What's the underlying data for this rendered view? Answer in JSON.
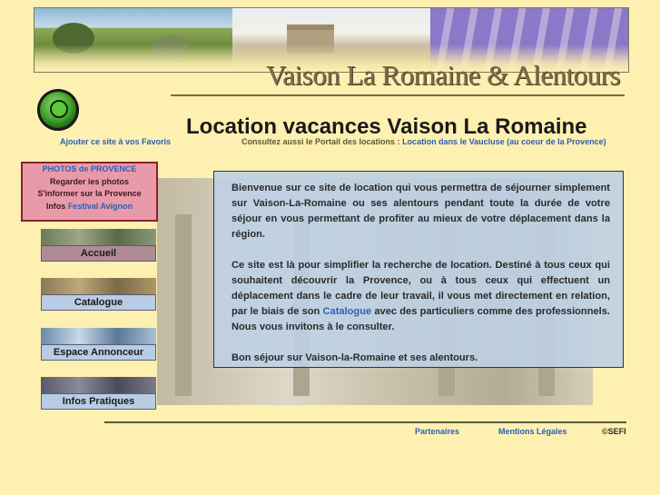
{
  "header": {
    "site_title": "Vaison La Romaine & Alentours"
  },
  "main": {
    "heading": "Location vacances Vaison La Romaine",
    "favorites_link": "Ajouter ce site à vos Favoris",
    "portal_text": "Consultez aussi le Portail des locations :",
    "portal_link": "Location dans le Vaucluse (au coeur de la Provence)"
  },
  "sidebar": {
    "box_items": [
      {
        "prefix": "",
        "label": "PHOTOS de PROVENCE",
        "highlight": true
      },
      {
        "prefix": "",
        "label": "Regarder les photos",
        "highlight": false
      },
      {
        "prefix": "",
        "label": "S'informer sur la Provence",
        "highlight": false
      },
      {
        "prefix": "Infos ",
        "label": "Festival Avignon",
        "highlight": true
      }
    ],
    "nav": [
      {
        "label": "Accueil"
      },
      {
        "label": "Catalogue"
      },
      {
        "label": "Espace Annonceur"
      },
      {
        "label": "Infos Pratiques"
      }
    ]
  },
  "content": {
    "p1": "Bienvenue sur ce site de location qui vous permettra de séjourner simplement sur Vaison-La-Romaine ou ses alentours pendant toute la durée de votre séjour en vous permettant de profiter au mieux de votre déplacement dans la région.",
    "p2_before": "Ce site est là pour simplifier la recherche de location. Destiné à tous ceux qui souhaitent découvrir la Provence, ou à tous ceux qui effectuent un déplacement dans le cadre de leur travail, il vous met directement en relation, par le biais de son ",
    "p2_link": "Catalogue",
    "p2_after": " avec des particuliers comme des professionnels. Nous vous invitons à le consulter.",
    "p3": "Bon séjour sur Vaison-la-Romaine et ses alentours."
  },
  "footer": {
    "partners": "Partenaires",
    "legal": "Mentions Légales",
    "copyright": "©SEFI"
  },
  "colors": {
    "background": "#fdf0b0",
    "link": "#2b5fb8",
    "menu_box": "#e99aa8",
    "content_panel": "#bed0e4"
  }
}
